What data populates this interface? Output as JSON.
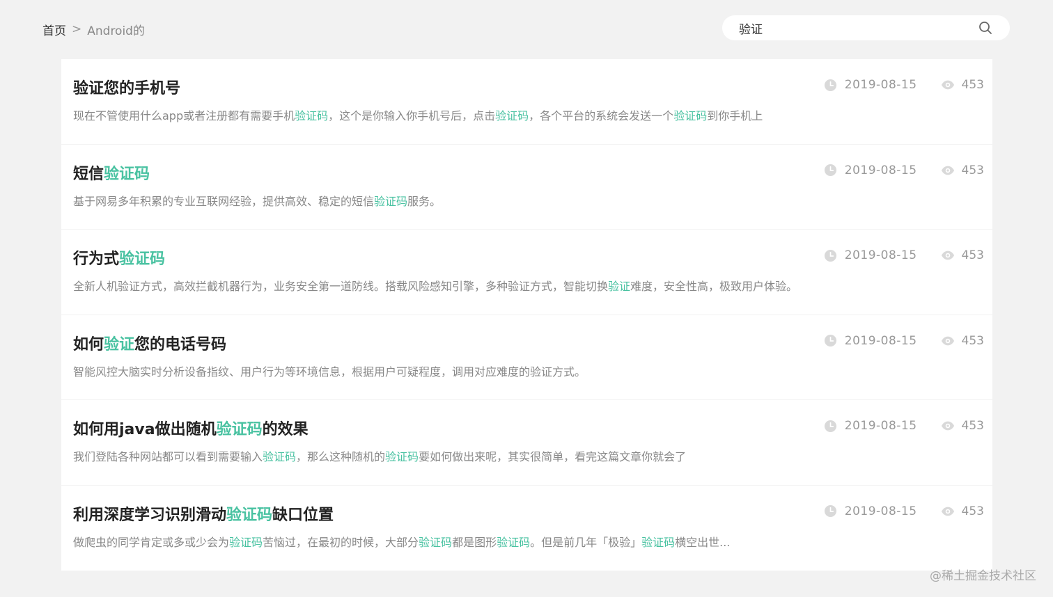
{
  "breadcrumb": {
    "home": "首页",
    "separator": ">",
    "current": "Android的"
  },
  "search": {
    "value": "验证",
    "icon": "search-icon"
  },
  "colors": {
    "highlight": "#49c2a1",
    "background": "#f2f2f2"
  },
  "items": [
    {
      "title": [
        {
          "t": "验证您的手机号",
          "h": false
        }
      ],
      "desc": [
        {
          "t": "现在不管使用什么app或者注册都有需要手机",
          "h": false
        },
        {
          "t": "验证码",
          "h": true
        },
        {
          "t": "，这个是你输入你手机号后，点击",
          "h": false
        },
        {
          "t": "验证码",
          "h": true
        },
        {
          "t": "，各个平台的系统会发送一个",
          "h": false
        },
        {
          "t": "验证码",
          "h": true
        },
        {
          "t": "到你手机上",
          "h": false
        }
      ],
      "date": "2019-08-15",
      "views": "453"
    },
    {
      "title": [
        {
          "t": "短信",
          "h": false
        },
        {
          "t": "验证码",
          "h": true
        }
      ],
      "desc": [
        {
          "t": "基于网易多年积累的专业互联网经验，提供高效、稳定的短信",
          "h": false
        },
        {
          "t": "验证码",
          "h": true
        },
        {
          "t": "服务。",
          "h": false
        }
      ],
      "date": "2019-08-15",
      "views": "453"
    },
    {
      "title": [
        {
          "t": "行为式",
          "h": false
        },
        {
          "t": "验证码",
          "h": true
        }
      ],
      "desc": [
        {
          "t": "全新人机验证方式，高效拦截机器行为，业务安全第一道防线。搭载风险感知引擎，多种验证方式，智能切换",
          "h": false
        },
        {
          "t": "验证",
          "h": true
        },
        {
          "t": "难度，安全性高，极致用户体验。",
          "h": false
        }
      ],
      "date": "2019-08-15",
      "views": "453"
    },
    {
      "title": [
        {
          "t": "如何",
          "h": false
        },
        {
          "t": "验证",
          "h": true
        },
        {
          "t": "您的电话号码",
          "h": false
        }
      ],
      "desc": [
        {
          "t": "智能风控大脑实时分析设备指纹、用户行为等环境信息，根据用户可疑程度，调用对应难度的验证方式。",
          "h": false
        }
      ],
      "date": "2019-08-15",
      "views": "453"
    },
    {
      "title": [
        {
          "t": "如何用java做出随机",
          "h": false
        },
        {
          "t": "验证码",
          "h": true
        },
        {
          "t": "的效果",
          "h": false
        }
      ],
      "desc": [
        {
          "t": "我们登陆各种网站都可以看到需要输入",
          "h": false
        },
        {
          "t": "验证码",
          "h": true
        },
        {
          "t": "，那么这种随机的",
          "h": false
        },
        {
          "t": "验证码",
          "h": true
        },
        {
          "t": "要如何做出来呢，其实很简单，看完这篇文章你就会了",
          "h": false
        }
      ],
      "date": "2019-08-15",
      "views": "453"
    },
    {
      "title": [
        {
          "t": "利用深度学习识别滑动",
          "h": false
        },
        {
          "t": "验证码",
          "h": true
        },
        {
          "t": "缺口位置",
          "h": false
        }
      ],
      "desc": [
        {
          "t": "做爬虫的同学肯定或多或少会为",
          "h": false
        },
        {
          "t": "验证码",
          "h": true
        },
        {
          "t": "苦恼过，在最初的时候，大部分",
          "h": false
        },
        {
          "t": "验证码",
          "h": true
        },
        {
          "t": "都是图形",
          "h": false
        },
        {
          "t": "验证码",
          "h": true
        },
        {
          "t": "。但是前几年「极验」",
          "h": false
        },
        {
          "t": "验证码",
          "h": true
        },
        {
          "t": "横空出世...",
          "h": false
        }
      ],
      "date": "2019-08-15",
      "views": "453"
    }
  ],
  "watermark": "@稀土掘金技术社区"
}
